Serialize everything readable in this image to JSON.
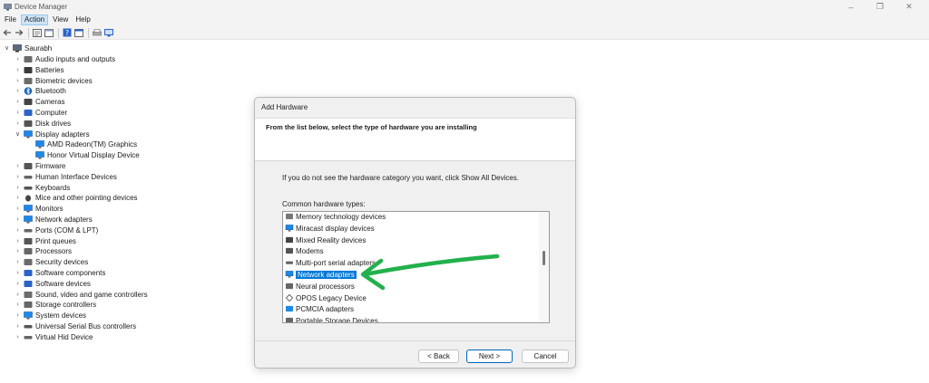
{
  "window": {
    "title": "Device Manager"
  },
  "menu": [
    "File",
    "Action",
    "View",
    "Help"
  ],
  "tree": {
    "root": "Saurabh",
    "categories": [
      {
        "label": "Audio inputs and outputs",
        "icon": "speaker-icon"
      },
      {
        "label": "Batteries",
        "icon": "battery-icon"
      },
      {
        "label": "Biometric devices",
        "icon": "fingerprint-icon"
      },
      {
        "label": "Bluetooth",
        "icon": "bluetooth-icon"
      },
      {
        "label": "Cameras",
        "icon": "camera-icon"
      },
      {
        "label": "Computer",
        "icon": "computer-icon"
      },
      {
        "label": "Disk drives",
        "icon": "disk-icon"
      },
      {
        "label": "Display adapters",
        "icon": "monitor-icon",
        "expanded": true,
        "children": [
          "AMD Radeon(TM) Graphics",
          "Honor Virtual Display Device"
        ]
      },
      {
        "label": "Firmware",
        "icon": "chip-icon"
      },
      {
        "label": "Human Interface Devices",
        "icon": "hid-icon"
      },
      {
        "label": "Keyboards",
        "icon": "keyboard-icon"
      },
      {
        "label": "Mice and other pointing devices",
        "icon": "mouse-icon"
      },
      {
        "label": "Monitors",
        "icon": "monitor-icon"
      },
      {
        "label": "Network adapters",
        "icon": "network-icon"
      },
      {
        "label": "Ports (COM & LPT)",
        "icon": "port-icon"
      },
      {
        "label": "Print queues",
        "icon": "printer-icon"
      },
      {
        "label": "Processors",
        "icon": "processor-icon"
      },
      {
        "label": "Security devices",
        "icon": "security-icon"
      },
      {
        "label": "Software components",
        "icon": "software-components-icon"
      },
      {
        "label": "Software devices",
        "icon": "software-device-icon"
      },
      {
        "label": "Sound, video and game controllers",
        "icon": "speaker-icon"
      },
      {
        "label": "Storage controllers",
        "icon": "storage-icon"
      },
      {
        "label": "System devices",
        "icon": "system-icon"
      },
      {
        "label": "Universal Serial Bus controllers",
        "icon": "usb-icon"
      },
      {
        "label": "Virtual Hid Device",
        "icon": "hid-icon"
      }
    ]
  },
  "dialog": {
    "title": "Add Hardware",
    "header": "From the list below, select the type of hardware you are installing",
    "info": "If you do not see the hardware category you want, click Show All Devices.",
    "list_label": "Common hardware types:",
    "items": [
      {
        "label": "Memory technology devices",
        "icon": "memory-icon"
      },
      {
        "label": "Miracast display devices",
        "icon": "cast-icon"
      },
      {
        "label": "Mixed Reality devices",
        "icon": "headset-icon"
      },
      {
        "label": "Modems",
        "icon": "modem-icon"
      },
      {
        "label": "Multi-port serial adapters",
        "icon": "port-icon"
      },
      {
        "label": "Network adapters",
        "icon": "network-icon",
        "selected": true
      },
      {
        "label": "Neural processors",
        "icon": "processor-icon"
      },
      {
        "label": "OPOS Legacy Device",
        "icon": "diamond-icon"
      },
      {
        "label": "PCMCIA adapters",
        "icon": "card-icon"
      },
      {
        "label": "Portable Storage Devices",
        "icon": "storage-icon"
      }
    ],
    "buttons": {
      "back": "< Back",
      "next": "Next >",
      "cancel": "Cancel"
    }
  },
  "colors": {
    "selection": "#0078d7",
    "arrow": "#22b14c",
    "dialog_bg": "#f0f0f0"
  }
}
